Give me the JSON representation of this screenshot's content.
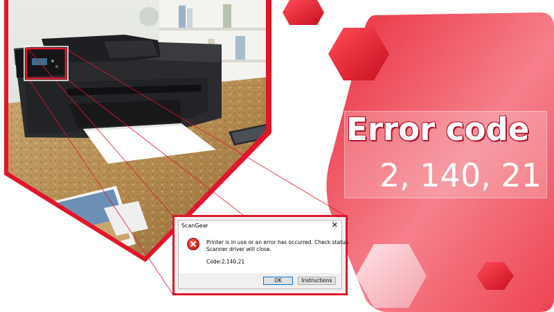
{
  "banner": {
    "title": "Error code",
    "code": "2, 140, 21"
  },
  "dialog": {
    "title": "ScanGear",
    "close_glyph": "✕",
    "message_line1": "Printer is in use or an error has occurred. Check status.",
    "message_line2": "Scanner driver will close.",
    "code_text": "Code:2,140,21",
    "ok_label": "OK",
    "instructions_label": "Instructions",
    "icon": "error-icon"
  },
  "colors": {
    "brand_red": "#e0162b",
    "light_red": "#f2737e",
    "white": "#ffffff"
  }
}
